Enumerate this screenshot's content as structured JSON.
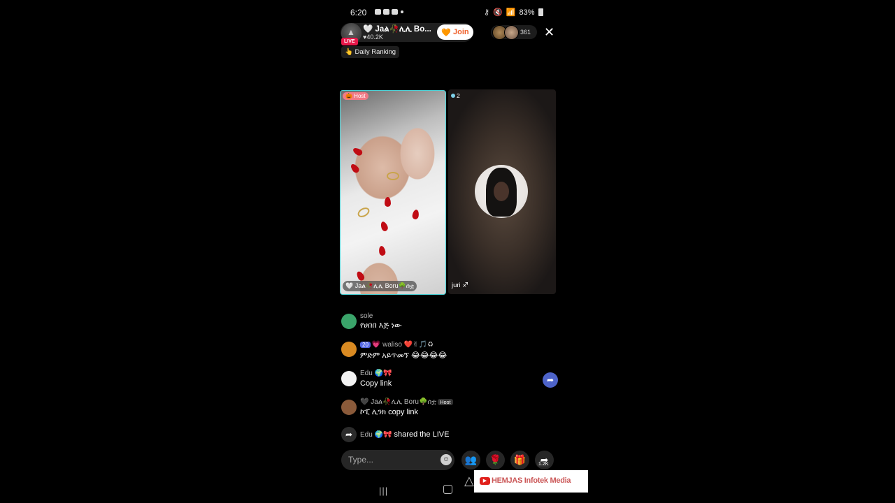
{
  "status_bar": {
    "time": "6:20",
    "battery": "83%"
  },
  "header": {
    "live_label": "LIVE",
    "host_name": "🤍 Jaል🥀ሊሊ Bo...",
    "likes": "♥40.2K",
    "join_label": "Join",
    "viewer_count": "361",
    "close": "✕",
    "daily_ranking": "👆 Daily Ranking"
  },
  "tiles": {
    "host": {
      "tag": "🎃 Host",
      "name": "🤍 Jaል🥀ሊሊ Boru🌳ሰቷ"
    },
    "guest": {
      "number": "2",
      "name": "juri ♐"
    }
  },
  "comments": [
    {
      "name": "sole",
      "text": "የሀበበ እጅ ነው",
      "avatar_color": "#3aa46a"
    },
    {
      "level": "20",
      "name": "💗 waliso ❤️✌🎵♻",
      "text": "ምድም አይጥመኘ 😂😂😂😂",
      "avatar_color": "#d98a22"
    },
    {
      "name": "Edu 🌍🎀",
      "text": "Copy link",
      "avatar_color": "#f2f2f2"
    },
    {
      "name": "🖤 Jaል🥀ሊሊ Boru🌳ሰቷ",
      "host_badge": "Host",
      "text": "ኮፒ ሊንክ copy link",
      "avatar_color": "#8a5a3a"
    }
  ],
  "shared_event": {
    "user": "Edu 🌍🎀",
    "action": "shared the LIVE"
  },
  "input": {
    "placeholder": "Type..."
  },
  "actions": {
    "share_count": "1.2K"
  },
  "watermark": {
    "text": "HEMJAS Infotek Media"
  }
}
